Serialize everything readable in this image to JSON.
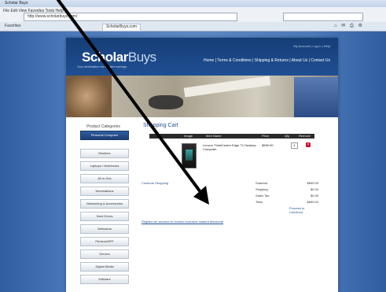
{
  "browser": {
    "title": "Scholar Buys",
    "menu": "File  Edit  View  Favorites  Tools  Help",
    "address": "http://www.scholarbuys.com/",
    "tabs": [
      "Favorites",
      "ScholarBuys.com"
    ],
    "tools": "⌂ ✉ ⎙ ⚙"
  },
  "site": {
    "logo_bold": "Scholar",
    "logo_light": "Buys",
    "tagline": "Your destination for student savings",
    "toplinks": "My Account | Log In | Help",
    "nav": "Home | Terms & Conditions | Shipping & Returns | About Us | Contact Us"
  },
  "sidebar": {
    "title": "Product Categories",
    "items": [
      "Personal Computer",
      "Monitors",
      "Laptops / Notebooks",
      "All in One",
      "Workstations",
      "Networking & Accessories",
      "Hard Drives",
      "Webcams",
      "Printers/MFP",
      "Servers",
      "Digital Media",
      "Software"
    ]
  },
  "cart": {
    "title": "Shopping Cart",
    "headers": [
      "Image",
      "Item Name",
      "Price",
      "Qty",
      "Remove"
    ],
    "item": {
      "name": "Lenovo ThinkCentre Edge 71 Desktop Computer",
      "price": "$899.00",
      "qty": "1",
      "remove": "×"
    },
    "continue_label": "Continue Shopping",
    "totals": [
      {
        "label": "Subtotal:",
        "value": "$899.00"
      },
      {
        "label": "Shipping:",
        "value": "$0.00"
      },
      {
        "label": "Sales Tax:",
        "value": "$0.00"
      },
      {
        "label": "Total:",
        "value": "$899.00"
      }
    ],
    "checkout_label": "Proceed to Checkout",
    "note": "Register an account to receive exclusive student discounts"
  }
}
